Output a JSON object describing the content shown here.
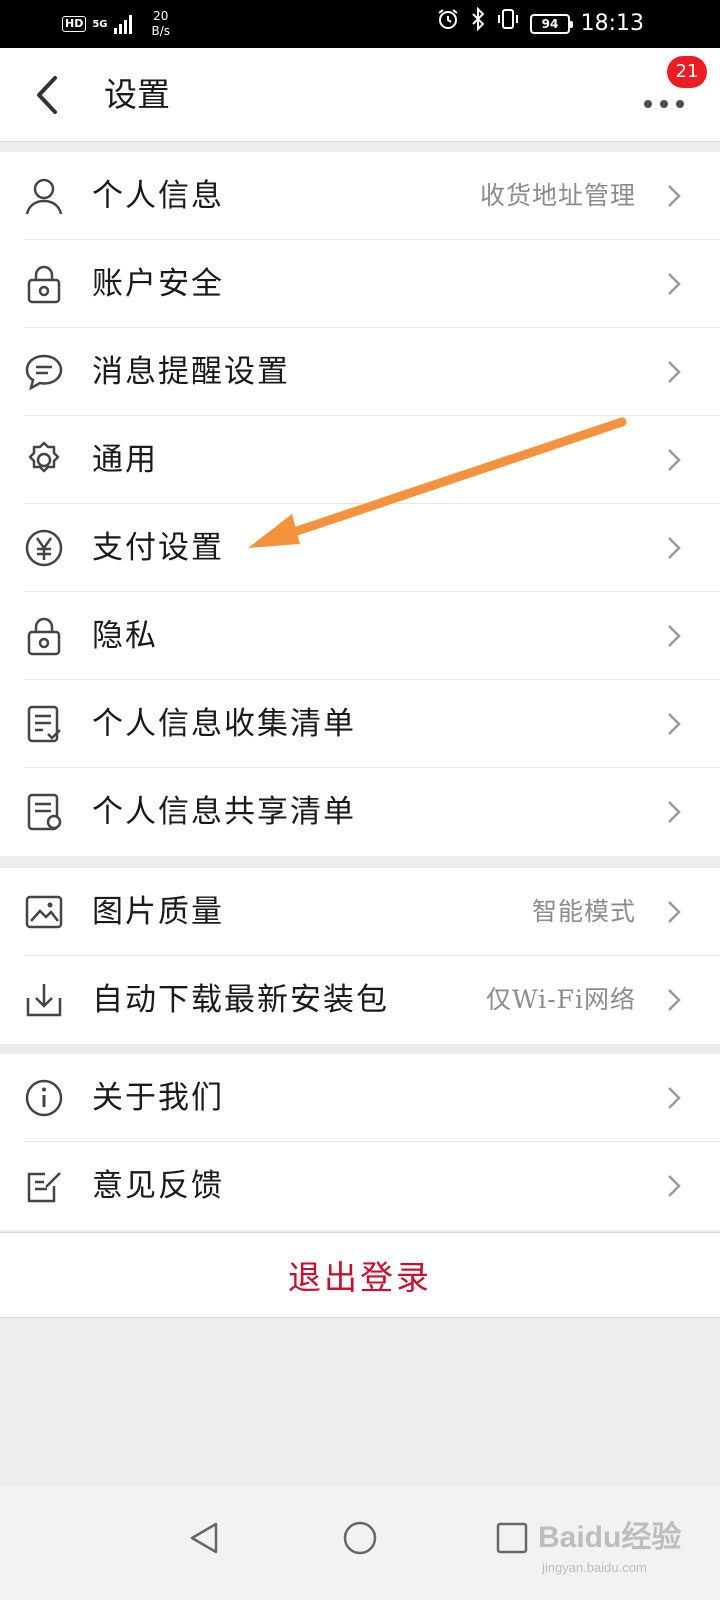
{
  "status_bar": {
    "hd": "HD",
    "network": "5G",
    "speed_value": "20",
    "speed_unit": "B/s",
    "battery": "94",
    "time": "18:13",
    "icons": [
      "alarm-icon",
      "bluetooth-icon",
      "vibrate-icon",
      "battery-icon"
    ]
  },
  "header": {
    "back_icon": "chevron-left-icon",
    "title": "设置",
    "more_icon": "more-dots-icon",
    "badge_count": "21"
  },
  "groups": [
    {
      "items": [
        {
          "icon": "person-icon",
          "label": "个人信息",
          "value": "收货地址管理"
        },
        {
          "icon": "lock-icon",
          "label": "账户安全",
          "value": ""
        },
        {
          "icon": "message-icon",
          "label": "消息提醒设置",
          "value": ""
        },
        {
          "icon": "gear-icon",
          "label": "通用",
          "value": ""
        },
        {
          "icon": "yuan-icon",
          "label": "支付设置",
          "value": ""
        },
        {
          "icon": "lock-icon",
          "label": "隐私",
          "value": ""
        },
        {
          "icon": "list-check-icon",
          "label": "个人信息收集清单",
          "value": ""
        },
        {
          "icon": "list-share-icon",
          "label": "个人信息共享清单",
          "value": ""
        }
      ]
    },
    {
      "items": [
        {
          "icon": "image-icon",
          "label": "图片质量",
          "value": "智能模式"
        },
        {
          "icon": "download-icon",
          "label": "自动下载最新安装包",
          "value": "仅Wi-Fi网络"
        }
      ]
    },
    {
      "items": [
        {
          "icon": "info-icon",
          "label": "关于我们",
          "value": ""
        },
        {
          "icon": "feedback-icon",
          "label": "意见反馈",
          "value": ""
        }
      ]
    }
  ],
  "logout_label": "退出登录",
  "annotation": {
    "color": "#f5923e",
    "points_to": "支付设置"
  },
  "nav_bar": {
    "icons": [
      "nav-back-icon",
      "nav-home-icon",
      "nav-recents-icon"
    ]
  },
  "watermark": {
    "text": "Baidu经验",
    "sub": "jingyan.baidu.com"
  },
  "colors": {
    "accent": "#c8102e",
    "badge": "#ec1c24",
    "background": "#ededed"
  }
}
